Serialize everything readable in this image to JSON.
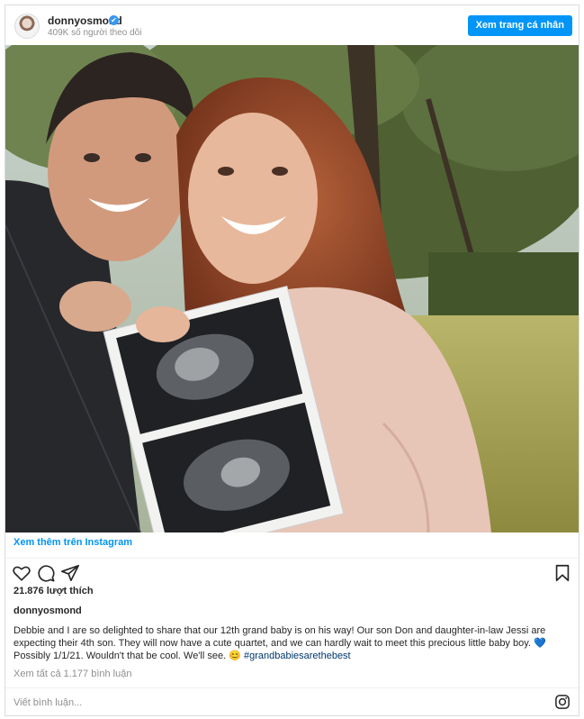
{
  "header": {
    "username": "donnyosmond",
    "verified_mark": "✔",
    "followers": "409K số người theo dõi",
    "view_profile_label": "Xem trang cá nhân"
  },
  "post": {
    "more_on_instagram": "Xem thêm trên Instagram",
    "likes": "21.876 lượt thích",
    "caption_user": "donnyosmond",
    "caption_text": "Debbie and I are so delighted to share that our 12th grand baby is on his way! Our son Don and daughter-in-law Jessi are expecting their 4th son. They will now have a cute quartet, and we can hardly wait to meet this precious little baby boy. 💙 Possibly 1/1/21. Wouldn't that be cool. We'll see. 😊",
    "hashtag": "#grandbabiesarethebest",
    "view_comments": "Xem tất cả 1.177 bình luận",
    "comment_placeholder": "Viết bình luận..."
  },
  "icons": {
    "verified": "verified-badge-icon",
    "like": "heart-icon",
    "comment": "comment-icon",
    "share": "share-icon",
    "save": "bookmark-icon",
    "instagram": "instagram-icon"
  },
  "colors": {
    "accent": "#0095f6",
    "border": "#dbdbdb",
    "muted": "#8e8e8e"
  }
}
